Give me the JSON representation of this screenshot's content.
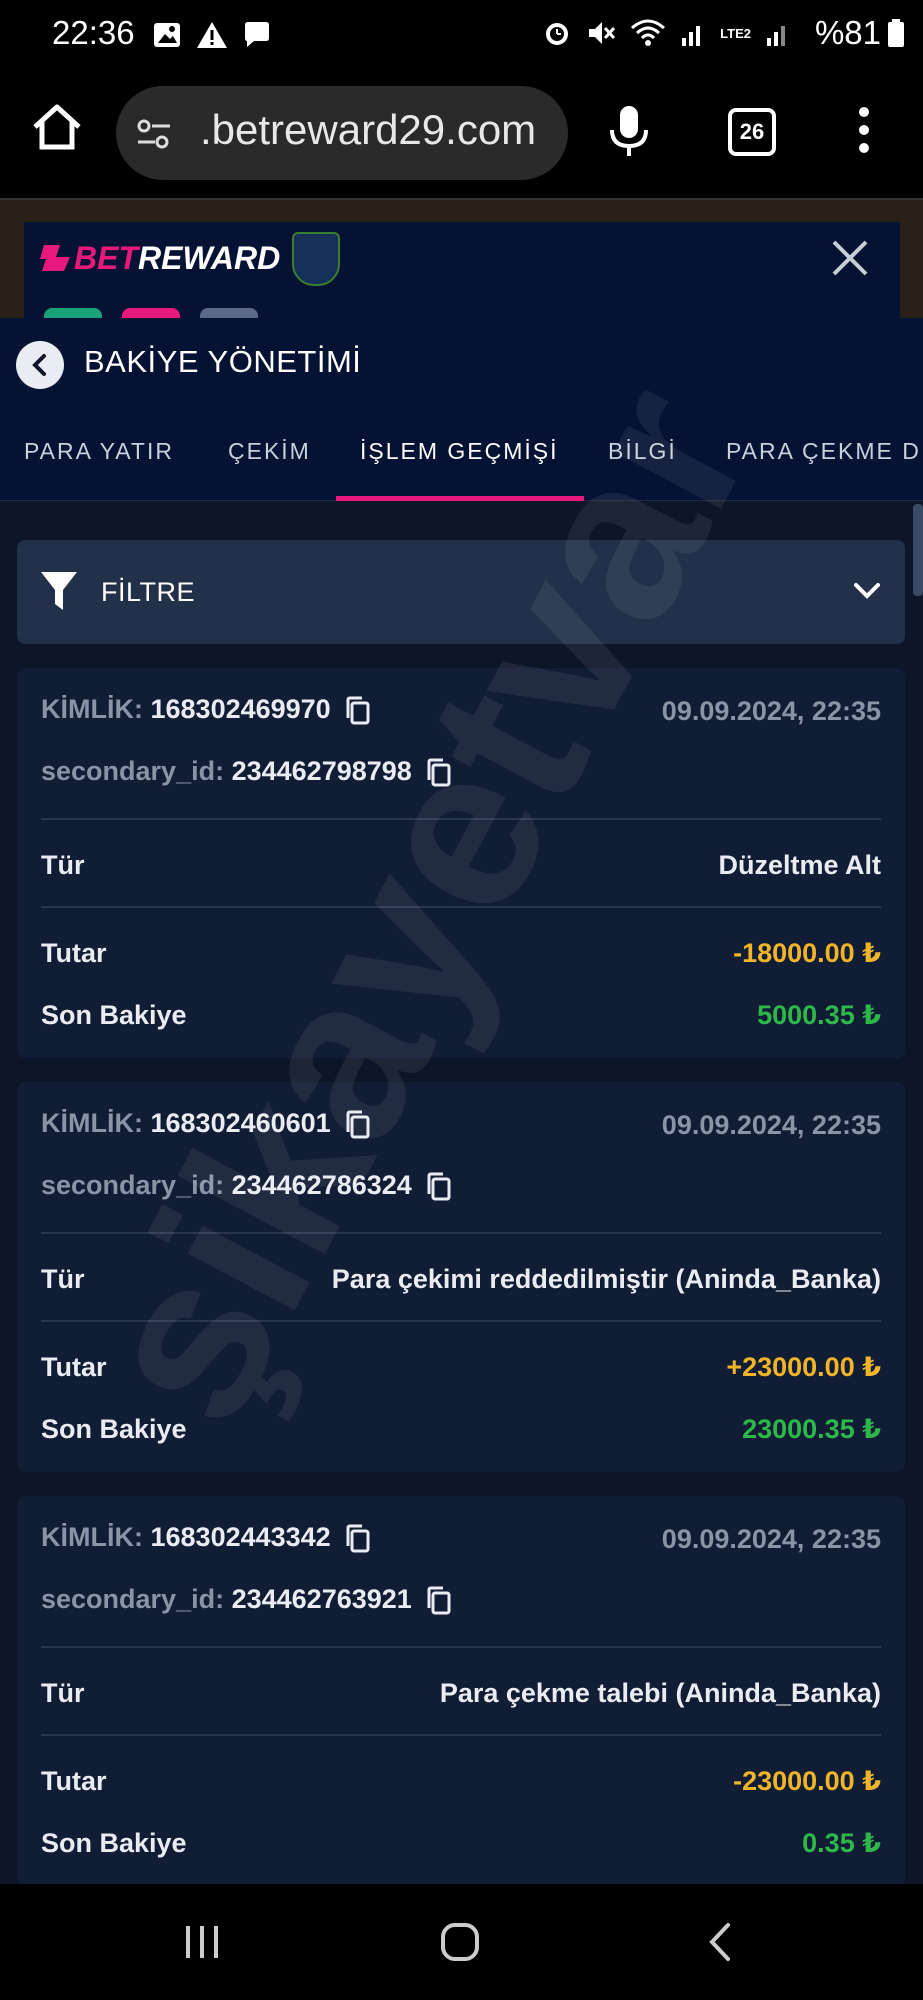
{
  "status_bar": {
    "time": "22:36",
    "battery": "%81",
    "network": "LTE2"
  },
  "browser": {
    "url": ".betreward29.com",
    "tab_count": "26"
  },
  "site": {
    "brand_prefix": "BET",
    "brand_suffix": "REWARD"
  },
  "panel": {
    "title": "BAKİYE YÖNETİMİ",
    "tabs": [
      {
        "label": "PARA YATIR"
      },
      {
        "label": "ÇEKİM"
      },
      {
        "label": "İŞLEM GEÇMİŞİ"
      },
      {
        "label": "BİLGİ"
      },
      {
        "label": "PARA ÇEKME D"
      }
    ],
    "active_tab": "İŞLEM GEÇMİŞİ",
    "filter_label": "FİLTRE"
  },
  "labels": {
    "id": "KİMLİK:",
    "secondary": "secondary_id:",
    "type": "Tür",
    "amount": "Tutar",
    "balance": "Son Bakiye"
  },
  "transactions": [
    {
      "id": "168302469970",
      "date": "09.09.2024, 22:35",
      "secondary_id": "234462798798",
      "type": "Düzeltme Alt",
      "amount": "-18000.00 ₺",
      "balance": "5000.35 ₺"
    },
    {
      "id": "168302460601",
      "date": "09.09.2024, 22:35",
      "secondary_id": "234462786324",
      "type": "Para çekimi reddedilmiştir (Aninda_Banka)",
      "amount": "+23000.00 ₺",
      "balance": "23000.35 ₺"
    },
    {
      "id": "168302443342",
      "date": "09.09.2024, 22:35",
      "secondary_id": "234462763921",
      "type": "Para çekme talebi (Aninda_Banka)",
      "amount": "-23000.00 ₺",
      "balance": "0.35 ₺"
    }
  ],
  "watermark": "şikayetvar",
  "colors": {
    "accent": "#e8197d",
    "amount": "#f0b429",
    "balance": "#2db84a",
    "background": "#0d1528"
  }
}
